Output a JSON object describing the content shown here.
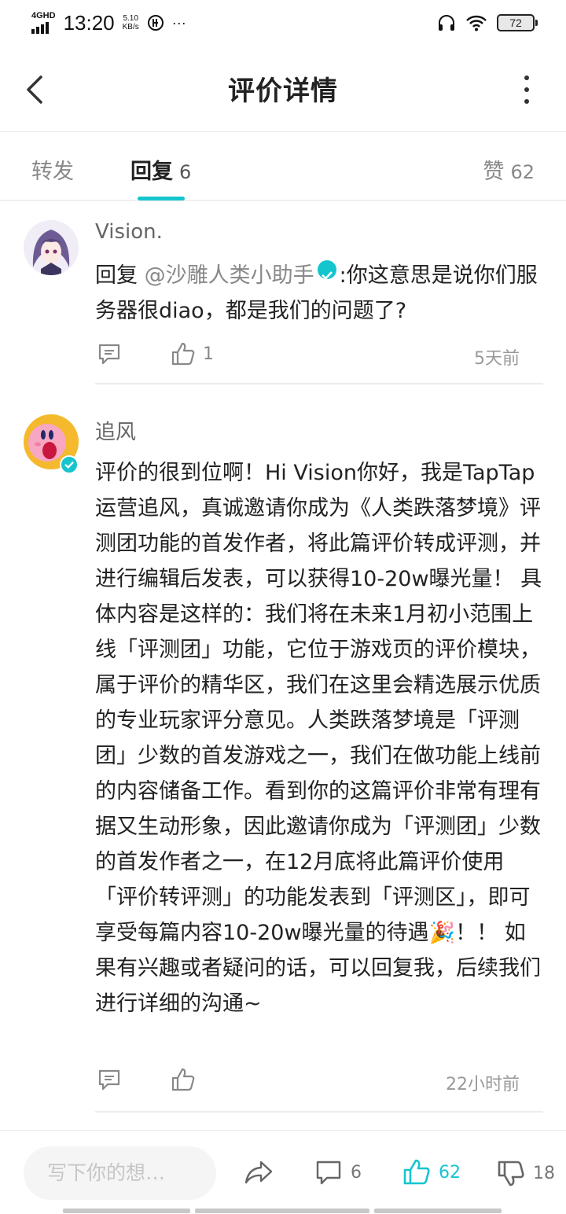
{
  "status_bar": {
    "network": "4GHD",
    "time": "13:20",
    "speed_value": "5.10",
    "speed_unit": "KB/s",
    "more": "···",
    "battery": "72"
  },
  "header": {
    "title": "评价详情"
  },
  "tabs": [
    {
      "label": "转发",
      "count": ""
    },
    {
      "label": "回复",
      "count": "6"
    },
    {
      "label": "赞",
      "count": "62"
    }
  ],
  "comments": [
    {
      "username": "Vision.",
      "reply_prefix": "回复",
      "mention": "@沙雕人类小助手",
      "text": ":你这意思是说你们服务器很diao，都是我们的问题了?",
      "likes": "1",
      "time": "5天前"
    },
    {
      "username": "追风",
      "text": "评价的很到位啊！Hi Vision你好，我是TapTap运营追风，真诚邀请你成为《人类跌落梦境》评测团功能的首发作者，将此篇评价转成评测，并进行编辑后发表，可以获得10-20w曝光量！ 具体内容是这样的：我们将在未来1月初小范围上线「评测团」功能，它位于游戏页的评价模块，属于评价的精华区，我们在这里会精选展示优质的专业玩家评分意见。人类跌落梦境是「评测团」少数的首发游戏之一，我们在做功能上线前的内容储备工作。看到你的这篇评价非常有理有据又生动形象，因此邀请你成为「评测团」少数的首发作者之一，在12月底将此篇评价使用「评价转评测」的功能发表到「评测区」，即可享受每篇内容10-20w曝光量的待遇",
      "text_after_emoji": "！！ 如果有兴趣或者疑问的话，可以回复我，后续我们进行详细的沟通~",
      "emoji": "🎉",
      "likes": "",
      "time": "22小时前"
    }
  ],
  "bottom_bar": {
    "input_placeholder": "写下你的想…",
    "reply_count": "6",
    "like_count": "62",
    "dislike_count": "18"
  },
  "colors": {
    "accent": "#15c5ce",
    "text_primary": "#222222",
    "text_secondary": "#888888"
  }
}
